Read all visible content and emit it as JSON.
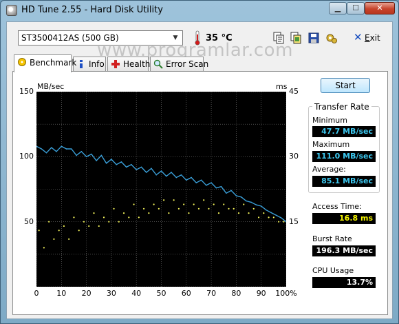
{
  "window": {
    "title": "HD Tune 2.55 - Hard Disk Utility"
  },
  "toolbar": {
    "drive": "ST3500412AS (500 GB)",
    "temperature": "35 °C",
    "exit_label": "Exit",
    "tools": [
      "copy-text-icon",
      "copy-image-icon",
      "save-icon",
      "options-icon"
    ]
  },
  "watermark": "www.programlar.com",
  "tabs": [
    {
      "label": "Benchmark",
      "active": true,
      "icon": "disk-icon"
    },
    {
      "label": "Info",
      "active": false,
      "icon": "info-icon"
    },
    {
      "label": "Health",
      "active": false,
      "icon": "health-cross-icon"
    },
    {
      "label": "Error Scan",
      "active": false,
      "icon": "magnifier-icon"
    }
  ],
  "benchmark": {
    "start_label": "Start",
    "transfer_rate_title": "Transfer Rate",
    "minimum_label": "Minimum",
    "minimum_value": "47.7 MB/sec",
    "maximum_label": "Maximum",
    "maximum_value": "111.0 MB/sec",
    "average_label": "Average:",
    "average_value": "85.1 MB/sec",
    "access_time_label": "Access Time:",
    "access_time_value": "16.8 ms",
    "burst_rate_label": "Burst Rate",
    "burst_rate_value": "196.3 MB/sec",
    "cpu_usage_label": "CPU Usage",
    "cpu_usage_value": "13.7%"
  },
  "colors": {
    "transfer": "#3a9fd8",
    "access": "#f2f25a",
    "grid": "#7a7a7a"
  },
  "chart_data": {
    "type": "line",
    "left_unit": "MB/sec",
    "right_unit": "ms",
    "left_ticks": [
      "150",
      "100",
      "50"
    ],
    "right_ticks": [
      "45",
      "30",
      "15"
    ],
    "x_ticks": [
      "0",
      "10",
      "20",
      "30",
      "40",
      "50",
      "60",
      "70",
      "80",
      "90",
      "100%"
    ],
    "xlim": [
      0,
      100
    ],
    "ylim_left": [
      0,
      150
    ],
    "ylim_right": [
      0,
      45
    ],
    "grid": true,
    "series": [
      {
        "axis": "left",
        "style": "line",
        "x": [
          0,
          2,
          4,
          6,
          8,
          10,
          12,
          14,
          16,
          18,
          20,
          22,
          24,
          26,
          28,
          30,
          32,
          34,
          36,
          38,
          40,
          42,
          44,
          46,
          48,
          50,
          52,
          54,
          56,
          58,
          60,
          62,
          64,
          66,
          68,
          70,
          72,
          74,
          76,
          78,
          80,
          82,
          84,
          86,
          88,
          90,
          92,
          94,
          96,
          98,
          100
        ],
        "y": [
          108,
          106,
          103,
          107,
          104,
          108,
          106,
          106,
          101,
          104,
          100,
          102,
          97,
          101,
          95,
          98,
          94,
          96,
          92,
          94,
          90,
          92,
          88,
          91,
          86,
          89,
          85,
          88,
          84,
          86,
          82,
          84,
          80,
          82,
          78,
          80,
          76,
          77,
          72,
          74,
          70,
          69,
          66,
          65,
          63,
          62,
          59,
          57,
          55,
          53,
          50
        ]
      },
      {
        "axis": "right",
        "style": "scatter",
        "x": [
          1,
          3,
          5,
          7,
          9,
          11,
          13,
          15,
          17,
          19,
          21,
          23,
          25,
          27,
          29,
          31,
          33,
          35,
          37,
          39,
          41,
          43,
          45,
          47,
          49,
          51,
          53,
          55,
          57,
          59,
          61,
          63,
          65,
          67,
          69,
          71,
          73,
          75,
          77,
          79,
          81,
          83,
          85,
          87,
          89,
          91,
          93,
          95,
          97,
          99
        ],
        "y": [
          13,
          9,
          15,
          11,
          13,
          14,
          11,
          16,
          13,
          15,
          14,
          17,
          14,
          16,
          15,
          18,
          15,
          17,
          16,
          19,
          16,
          18,
          17,
          19,
          18,
          20,
          17,
          20,
          18,
          19,
          17,
          19,
          18,
          20,
          18,
          19,
          17,
          19,
          18,
          18,
          17,
          19,
          17,
          18,
          16,
          17,
          16,
          16,
          15,
          15
        ]
      }
    ]
  }
}
